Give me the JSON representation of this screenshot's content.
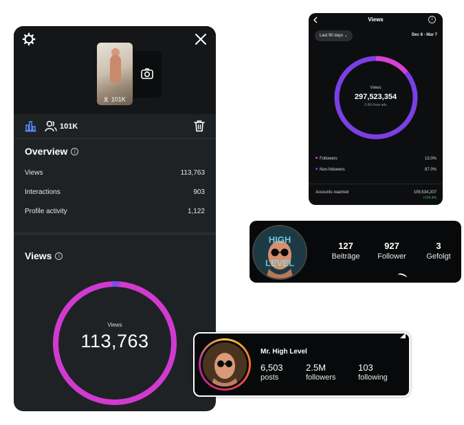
{
  "reel_insights": {
    "thumbnail_views": "101K",
    "reach_count": "101K",
    "overview": {
      "title": "Overview",
      "rows": [
        {
          "label": "Views",
          "value": "113,763"
        },
        {
          "label": "Interactions",
          "value": "903"
        },
        {
          "label": "Profile activity",
          "value": "1,122"
        }
      ]
    },
    "views": {
      "title": "Views",
      "donut_label": "Views",
      "donut_value": "113,763"
    }
  },
  "account_insights": {
    "title": "Views",
    "filter_label": "Last 90 days",
    "date_range": "Dec 8 - Mar 7",
    "donut_label": "Views",
    "donut_value": "297,523,354",
    "donut_sub": "0.9% from ads",
    "legend": [
      {
        "label": "Followers",
        "value": "13.0%",
        "color": "#d93fd0"
      },
      {
        "label": "Non-followers",
        "value": "87.0%",
        "color": "#7b3fe4"
      }
    ],
    "accounts_reached_label": "Accounts reached",
    "accounts_reached_value": "109,534,207",
    "accounts_reached_change": "+100.4%"
  },
  "profile_de": {
    "avatar_text_1": "HIGH",
    "avatar_text_2": "LEVEL",
    "stats": [
      {
        "value": "127",
        "label": "Beiträge"
      },
      {
        "value": "927",
        "label": "Follower"
      },
      {
        "value": "3",
        "label": "Gefolgt"
      }
    ]
  },
  "profile_en": {
    "name": "Mr. High Level",
    "stats": [
      {
        "value": "6,503",
        "label": "posts"
      },
      {
        "value": "2.5M",
        "label": "followers"
      },
      {
        "value": "103",
        "label": "following"
      }
    ]
  },
  "colors": {
    "followers": "#d93fd0",
    "non_followers": "#7b3fe4",
    "reel_views_ring": "#d13ad1",
    "reel_views_accent": "#7b4fe8"
  }
}
